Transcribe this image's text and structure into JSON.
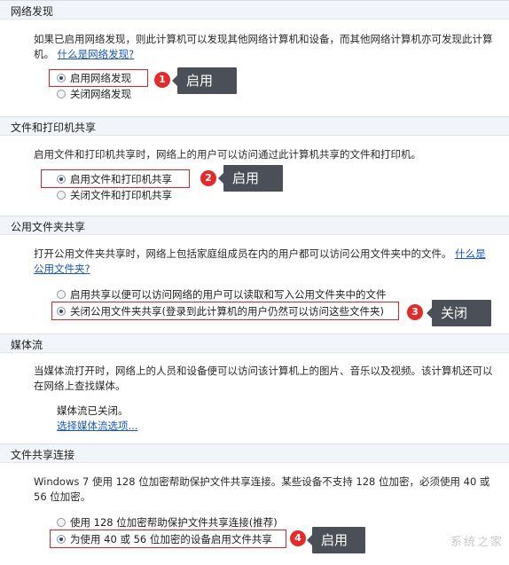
{
  "network_discovery": {
    "header": "网络发现",
    "desc_text": "如果已启用网络发现，则此计算机可以发现其他网络计算机和设备，而其他网络计算机亦可发现此计算机。",
    "desc_link": "什么是网络发现?",
    "option_on": "启用网络发现",
    "option_off": "关闭网络发现",
    "badge": "1",
    "callout": "启用"
  },
  "file_printer_sharing": {
    "header": "文件和打印机共享",
    "desc_text": "启用文件和打印机共享时，网络上的用户可以访问通过此计算机共享的文件和打印机。",
    "option_on": "启用文件和打印机共享",
    "option_off": "关闭文件和打印机共享",
    "badge": "2",
    "callout": "启用"
  },
  "public_folder_sharing": {
    "header": "公用文件夹共享",
    "desc_text": "打开公用文件夹共享时，网络上包括家庭组成员在内的用户都可以访问公用文件夹中的文件。",
    "desc_link": "什么是公用文件夹?",
    "option_on": "启用共享以便可以访问网络的用户可以读取和写入公用文件夹中的文件",
    "option_off": "关闭公用文件夹共享(登录到此计算机的用户仍然可以访问这些文件夹)",
    "badge": "3",
    "callout": "关闭"
  },
  "media_streaming": {
    "header": "媒体流",
    "desc_text": "当媒体流打开时，网络上的人员和设备便可以访问该计算机上的图片、音乐以及视频。该计算机还可以在网络上查找媒体。",
    "status": "媒体流已关闭。",
    "link": "选择媒体流选项..."
  },
  "file_sharing_connections": {
    "header": "文件共享连接",
    "desc_text": "Windows 7 使用 128 位加密帮助保护文件共享连接。某些设备不支持 128 位加密，必须使用 40 或 56 位加密。",
    "option_128": "使用 128 位加密帮助保护文件共享连接(推荐)",
    "option_40_56": "为使用 40 或 56 位加密的设备启用文件共享",
    "badge": "4",
    "callout": "启用"
  },
  "selected": {
    "network_discovery": "on",
    "file_printer_sharing": "on",
    "public_folder_sharing": "off",
    "file_sharing_connections": "40_56"
  },
  "colors": {
    "highlight_box": "#d9232a",
    "badge": "#e32b2b",
    "callout_bg": "#4b4f57",
    "link": "#1a57b8"
  },
  "watermark": "系统之家"
}
